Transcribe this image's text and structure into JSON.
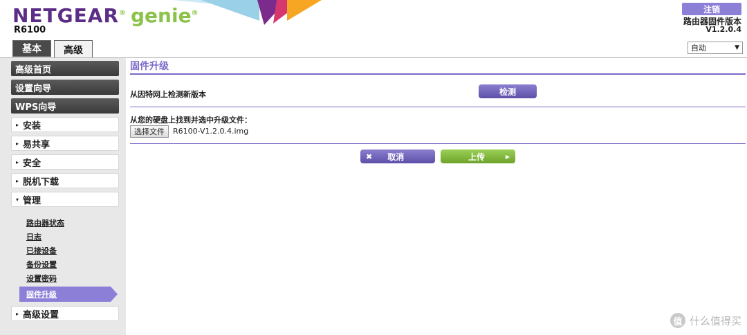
{
  "header": {
    "brand": "NETGEAR",
    "brand_reg": "®",
    "product": "genie",
    "product_reg": "®",
    "model": "R6100",
    "logout_label": "注销",
    "firmware_title": "路由器固件版本",
    "firmware_version": "V1.2.0.4",
    "language_selected": "自动",
    "tabs": [
      {
        "label": "基本",
        "active": false
      },
      {
        "label": "高级",
        "active": true
      }
    ],
    "colors": {
      "brand_purple": "#5b2d86",
      "genie_green": "#8bc34a",
      "accent_purple": "#8c7fd8"
    }
  },
  "sidebar": {
    "dark_items": [
      {
        "label": "高级首页"
      },
      {
        "label": "设置向导"
      },
      {
        "label": "WPS向导"
      }
    ],
    "light_items": [
      {
        "label": "安装",
        "marker": "▸"
      },
      {
        "label": "易共享",
        "marker": "▸"
      },
      {
        "label": "安全",
        "marker": "▸"
      },
      {
        "label": "脱机下载",
        "marker": "▸"
      },
      {
        "label": "管理",
        "marker": "▾"
      }
    ],
    "sub_items": [
      {
        "label": "路由器状态"
      },
      {
        "label": "日志"
      },
      {
        "label": "已接设备"
      },
      {
        "label": "备份设置"
      },
      {
        "label": "设置密码"
      },
      {
        "label": "固件升级",
        "active": true
      }
    ],
    "bottom_item": {
      "label": "高级设置",
      "marker": "▸"
    }
  },
  "main": {
    "title": "固件升级",
    "check_label": "从因特网上检测新版本",
    "check_button": "检测",
    "local_label": "从您的硬盘上找到并选中升级文件：",
    "choose_file_button": "选择文件",
    "file_name": "R6100-V1.2.0.4.img",
    "cancel_button": "取消",
    "upload_button": "上传"
  },
  "watermark": {
    "icon": "值",
    "text": "什么值得买"
  }
}
